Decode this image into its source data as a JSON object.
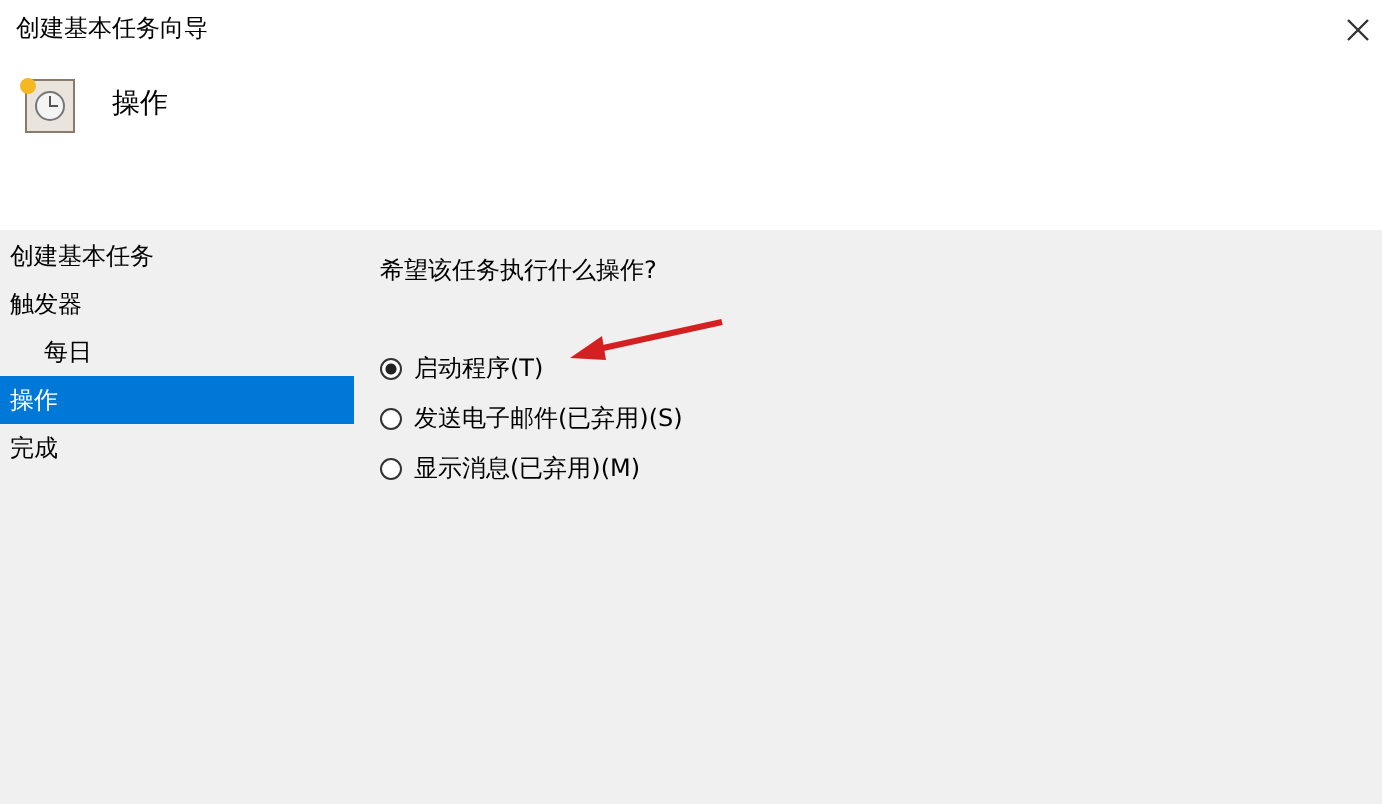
{
  "window": {
    "title": "创建基本任务向导"
  },
  "header": {
    "title": "操作"
  },
  "sidebar": {
    "items": [
      {
        "label": "创建基本任务",
        "selected": false
      },
      {
        "label": "触发器",
        "selected": false,
        "children": [
          {
            "label": "每日",
            "selected": false
          }
        ]
      },
      {
        "label": "操作",
        "selected": true
      },
      {
        "label": "完成",
        "selected": false
      }
    ]
  },
  "question": "希望该任务执行什么操作?",
  "options": [
    {
      "label": "启动程序(T)",
      "selected": true
    },
    {
      "label": "发送电子邮件(已弃用)(S)",
      "selected": false
    },
    {
      "label": "显示消息(已弃用)(M)",
      "selected": false
    }
  ]
}
